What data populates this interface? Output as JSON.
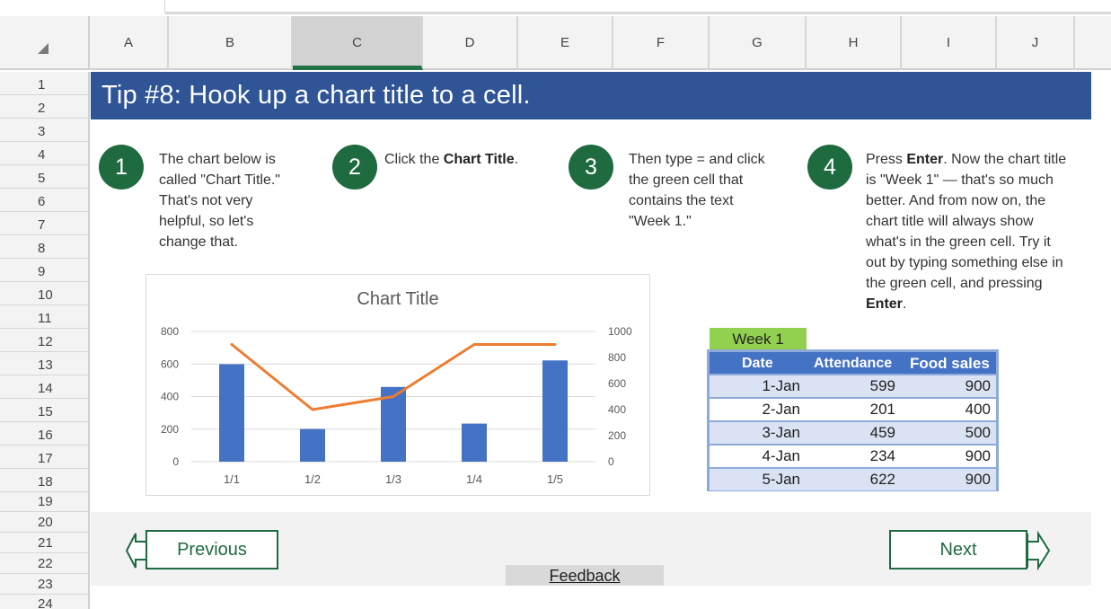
{
  "columns": [
    "A",
    "B",
    "C",
    "D",
    "E",
    "F",
    "G",
    "H",
    "I",
    "J"
  ],
  "selected_column": "C",
  "rows": [
    "1",
    "2",
    "3",
    "4",
    "5",
    "6",
    "7",
    "8",
    "9",
    "10",
    "11",
    "12",
    "13",
    "14",
    "15",
    "16",
    "17",
    "18",
    "19",
    "20",
    "21",
    "22",
    "23",
    "24"
  ],
  "tip_title": "Tip #8: Hook up a chart title to a cell.",
  "steps": [
    {
      "num": "1",
      "text_html": "The chart below is<br>called \"Chart Title.\"<br>That's not very<br>helpful, so let's<br>change that."
    },
    {
      "num": "2",
      "text_html": "Click the <b>Chart Title</b>."
    },
    {
      "num": "3",
      "text_html": "Then type = and click<br>the green cell that<br>contains the text<br>\"Week 1.\""
    },
    {
      "num": "4",
      "text_html": "Press <b>Enter</b>. Now the chart title<br>is \"Week 1\" — that's so much<br>better. And from now on, the<br>chart title will always show<br>what's in the green cell. Try it<br>out by typing something else in<br>the green cell, and pressing<br><b>Enter</b>."
    }
  ],
  "chart_data": {
    "type": "bar",
    "title": "Chart Title",
    "categories": [
      "1/1",
      "1/2",
      "1/3",
      "1/4",
      "1/5"
    ],
    "series": [
      {
        "values": [
          599,
          201,
          459,
          234,
          622
        ],
        "chart_kind": "bar",
        "axis": "left",
        "color": "#4472c4"
      },
      {
        "values": [
          900,
          400,
          500,
          900,
          900
        ],
        "chart_kind": "line",
        "axis": "right",
        "color": "#ed7d31"
      }
    ],
    "ylim": [
      0,
      800
    ],
    "y_ticks": [
      0,
      200,
      400,
      600,
      800
    ],
    "y2lim": [
      0,
      1000
    ],
    "y2_ticks": [
      0,
      200,
      400,
      600,
      800,
      1000
    ],
    "grid": true,
    "legend": "none"
  },
  "table": {
    "week_label": "Week 1",
    "headers": [
      "Date",
      "Attendance",
      "Food sales"
    ],
    "rows": [
      [
        "1-Jan",
        "599",
        "900"
      ],
      [
        "2-Jan",
        "201",
        "400"
      ],
      [
        "3-Jan",
        "459",
        "500"
      ],
      [
        "4-Jan",
        "234",
        "900"
      ],
      [
        "5-Jan",
        "622",
        "900"
      ]
    ]
  },
  "nav": {
    "previous": "Previous",
    "next": "Next",
    "feedback": "Feedback"
  },
  "colors": {
    "banner": "#2f5597",
    "step_circle": "#1e6b3f",
    "week_cell": "#92d050",
    "table_header": "#4472c4",
    "table_band": "#dae3f3",
    "bar": "#4472c4",
    "line": "#ed7d31"
  }
}
